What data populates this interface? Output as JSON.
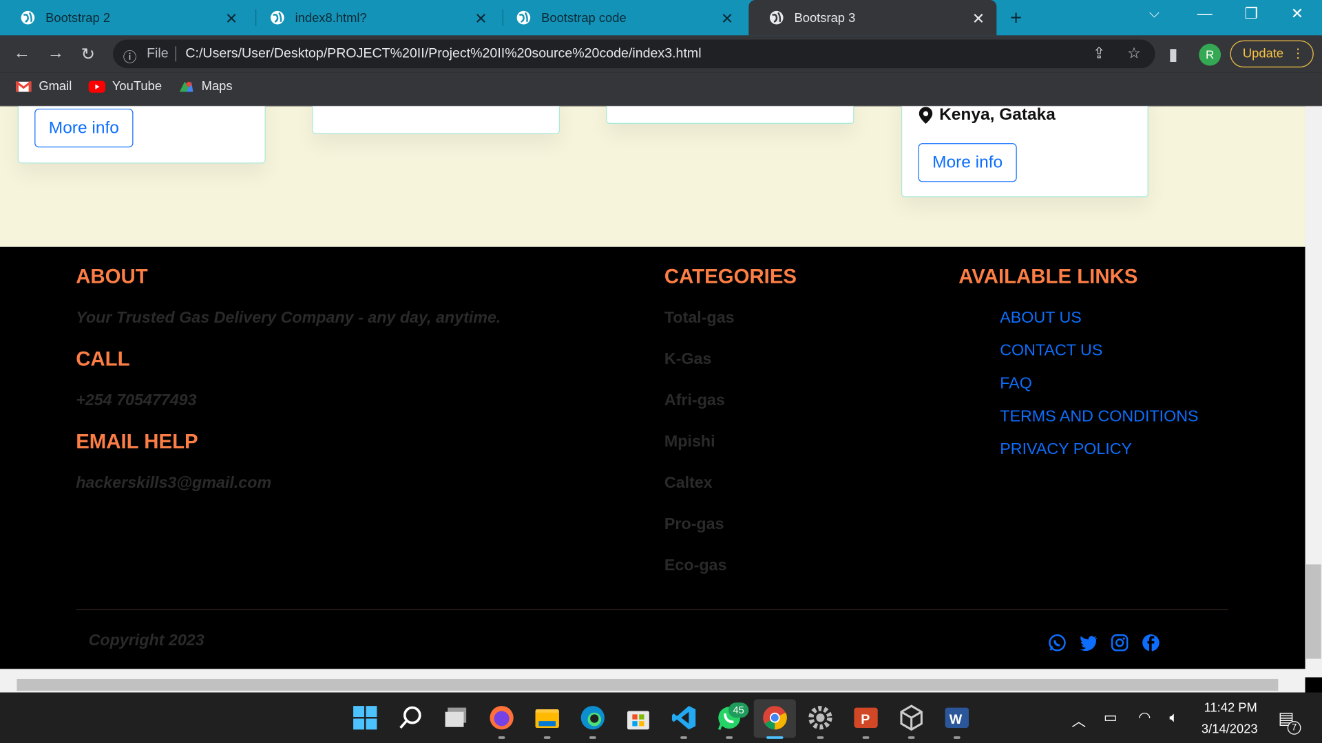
{
  "browser": {
    "tabs": [
      {
        "title": "Bootstrap 2"
      },
      {
        "title": "index8.html?"
      },
      {
        "title": "Bootstrap code"
      },
      {
        "title": "Bootsrap 3"
      }
    ],
    "omnibox": {
      "scheme": "File",
      "url": "C:/Users/User/Desktop/PROJECT%20II/Project%20II%20source%20code/index3.html"
    },
    "profile_initial": "R",
    "update_label": "Update",
    "bookmarks": [
      {
        "label": "Gmail"
      },
      {
        "label": "YouTube"
      },
      {
        "label": "Maps"
      }
    ]
  },
  "cards": {
    "more_info_label": "More info",
    "location": "Kenya, Gataka"
  },
  "footer": {
    "about": {
      "heading": "ABOUT",
      "text": "Your Trusted Gas Delivery Company - any day, anytime."
    },
    "call": {
      "heading": "CALL",
      "text": "+254 705477493"
    },
    "email": {
      "heading": "EMAIL HELP",
      "text": "hackerskills3@gmail.com"
    },
    "categories": {
      "heading": "CATEGORIES",
      "items": [
        "Total-gas",
        "K-Gas",
        "Afri-gas",
        "Mpishi",
        "Caltex",
        "Pro-gas",
        "Eco-gas"
      ]
    },
    "links": {
      "heading": "AVAILABLE LINKS",
      "items": [
        "ABOUT US",
        "CONTACT US",
        "FAQ",
        "TERMS AND CONDITIONS",
        "PRIVACY POLICY"
      ]
    },
    "copyright": "Copyright 2023",
    "social": [
      "whatsapp-icon",
      "twitter-icon",
      "instagram-icon",
      "facebook-icon"
    ]
  },
  "taskbar": {
    "whatsapp_badge": "45",
    "time": "11:42 PM",
    "date": "3/14/2023",
    "notifications": "7"
  },
  "colors": {
    "tabstrip": "#1493b8",
    "accent_orange": "#fd7e45",
    "link_blue": "#0d6efd",
    "cream": "#f7f4dc"
  }
}
